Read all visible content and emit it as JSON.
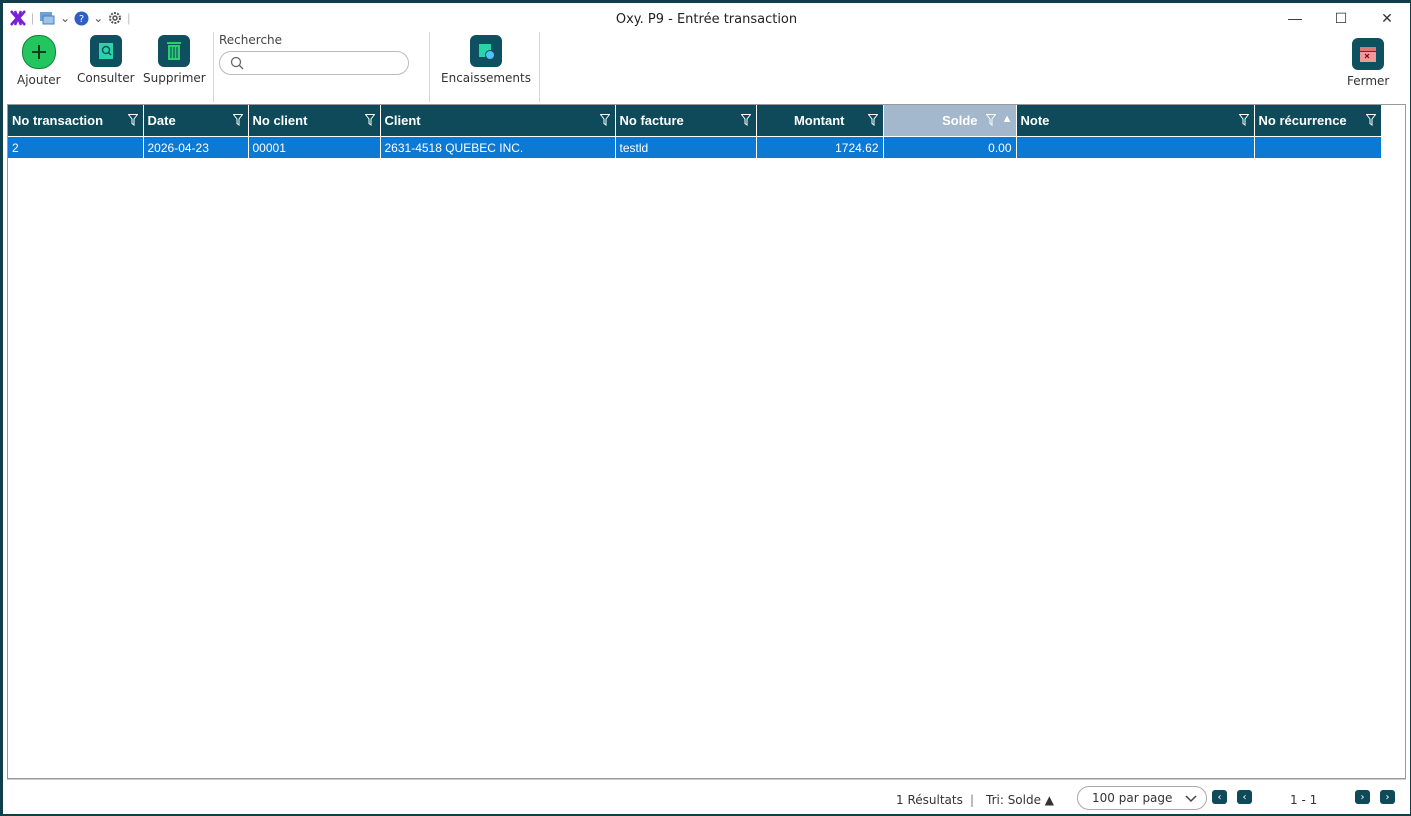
{
  "window": {
    "title": "Oxy. P9 - Entrée transaction"
  },
  "toolbar": {
    "add_label": "Ajouter",
    "view_label": "Consulter",
    "delete_label": "Supprimer",
    "search_label": "Recherche",
    "search_placeholder": "",
    "receipts_label": "Encaissements",
    "close_label": "Fermer"
  },
  "table": {
    "columns": [
      "No transaction",
      "Date",
      "No client",
      "Client",
      "No facture",
      "Montant",
      "Solde",
      "Note",
      "No récurrence"
    ],
    "sorted_column": "Solde",
    "rows": [
      [
        "2",
        "2026-04-23",
        "00001",
        "2631-4518 QUEBEC INC.",
        "testld",
        "1724.62",
        "0.00",
        "",
        ""
      ]
    ]
  },
  "footer": {
    "results": "1 Résultats",
    "divider": "|",
    "sort": "Tri: Solde ▲",
    "per_page": "100 par page",
    "range": "1 - 1"
  },
  "colors": {
    "header": "#0e4a5a",
    "selected_row": "#0c79d4",
    "sorted_header": "#a3b7cd"
  },
  "icons": [
    "logo-icon",
    "print-icon",
    "help-icon",
    "settings-icon",
    "add-icon",
    "view-icon",
    "delete-icon",
    "search-icon",
    "receipts-icon",
    "close-icon",
    "filter-icon"
  ]
}
